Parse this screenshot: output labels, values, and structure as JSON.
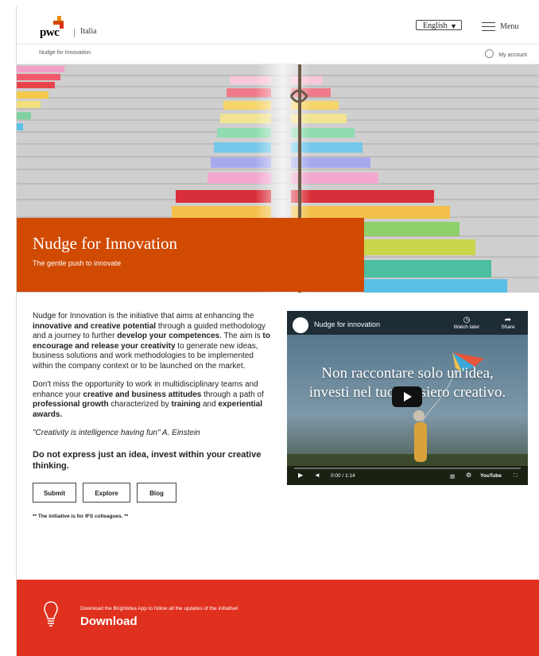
{
  "header": {
    "logo_text": "pwc",
    "region": "Italia",
    "language": "English",
    "menu_label": "Menu"
  },
  "subheader": {
    "breadcrumb": "Nudge for Innovation",
    "account": "My account"
  },
  "hero": {
    "title": "Nudge for Innovation",
    "subtitle": "The gentle push to innovate"
  },
  "body": {
    "p1_a": "Nudge for Innovation is the initiative that aims at enhancing the ",
    "p1_b": "innovative and creative potential",
    "p1_c": " through a guided methodology and a journey to further ",
    "p1_d": "develop your competences",
    "p1_e": ". The aim is ",
    "p1_f": "to encourage and release your creativity",
    "p1_g": " to generate new ideas, business solutions and work methodologies to be implemented within the company context or to be launched on the market.",
    "p2_a": "Don't miss the opportunity to work in multidisciplinary teams and enhance your ",
    "p2_b": "creative and business attitudes",
    "p2_c": " through a path of ",
    "p2_d": "professional growth",
    "p2_e": " characterized by ",
    "p2_f": "training",
    "p2_g": " and ",
    "p2_h": "experiential awards.",
    "quote": "\"Creativity is intelligence having fun\" A. Einstein",
    "tagline": "Do not express just an idea, invest within your creative thinking.",
    "buttons": [
      "Submit",
      "Explore",
      "Blog"
    ],
    "note": "** The initiative is for IFS colleagues. **"
  },
  "video": {
    "title": "Nudge for innovation",
    "watch_later": "Watch later",
    "share": "Share",
    "overlay_line1": "Non raccontare solo un'idea,",
    "overlay_line2": "investi nel tuo pensiero creativo.",
    "time": "0:00 / 1:14",
    "youtube": "YouTube"
  },
  "footer": {
    "small": "Download the Brightidea App to follow all the updates of the initiative!",
    "download": "Download"
  },
  "colors": {
    "brand_orange": "#d04a02",
    "footer_red": "#e0301e"
  }
}
